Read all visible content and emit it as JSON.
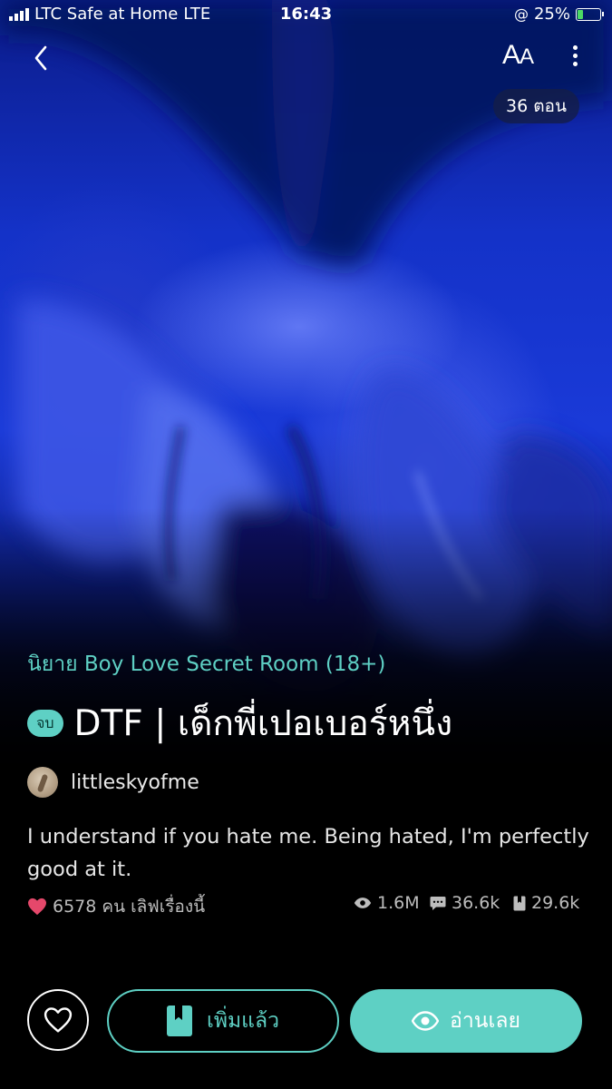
{
  "status_bar": {
    "carrier": "LTC Safe at Home",
    "network": "LTE",
    "time": "16:43",
    "battery_text": "25%",
    "battery_level": 0.25
  },
  "header": {
    "font_size_label": "A",
    "font_size_label_small": "A",
    "episodes_badge": "36 ตอน"
  },
  "story": {
    "category": "นิยาย Boy Love Secret Room (18+)",
    "status_badge": "จบ",
    "title": "DTF |  เด็กพี่เปอเบอร์หนึ่ง",
    "author": "littleskyofme",
    "synopsis": "I understand if you hate me. Being hated,  I'm perfectly good at it.",
    "likes_text": "6578 คน เลิฟเรื่องนี้",
    "views": "1.6M",
    "comments": "36.6k",
    "bookmarks": "29.6k"
  },
  "actions": {
    "add_label": "เพิ่มแล้ว",
    "read_label": "อ่านเลย"
  },
  "colors": {
    "accent": "#5ed0c4",
    "heart": "#e5486b",
    "background": "#000000"
  },
  "icons": [
    "back-chevron-icon",
    "font-size-icon",
    "more-vertical-icon",
    "heart-icon",
    "eye-icon",
    "comment-icon",
    "bookmark-icon",
    "heart-outline-icon",
    "book-icon"
  ]
}
